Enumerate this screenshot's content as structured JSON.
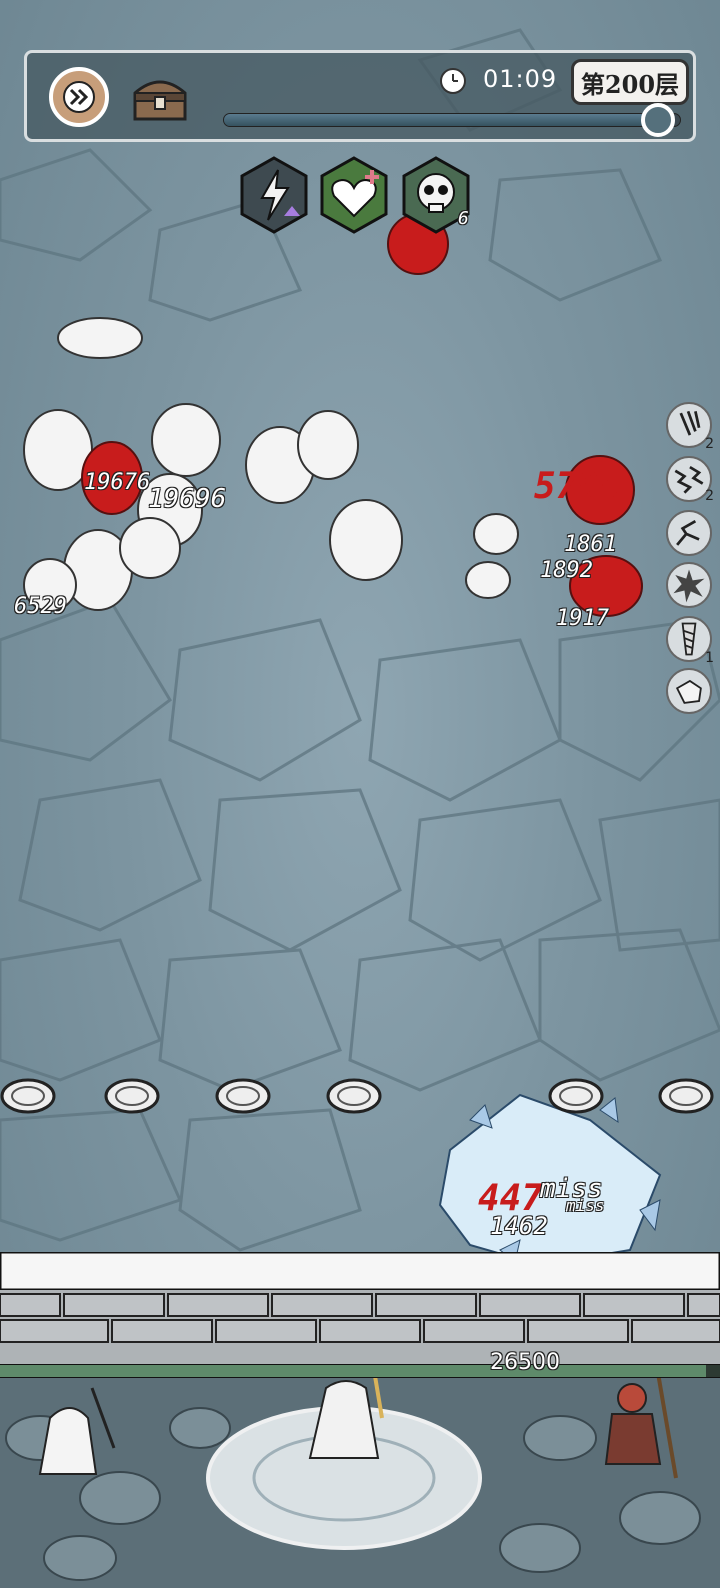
{
  "hud": {
    "fast_forward_icon": "fast-forward-icon",
    "chest_icon": "treasure-chest-icon",
    "clock_icon": "clock-icon",
    "timer": "01:09",
    "floor": "第200层",
    "wave_progress": 0.94
  },
  "buffs": [
    {
      "icon": "lightning-attack-up-icon"
    },
    {
      "icon": "heart-heal-icon"
    },
    {
      "icon": "skull-icon",
      "count": "6"
    }
  ],
  "damage_numbers": [
    {
      "text": "19676"
    },
    {
      "text": "19696"
    },
    {
      "text": "6529"
    },
    {
      "text": "5795",
      "style": "red"
    },
    {
      "text": "1861"
    },
    {
      "text": "1892"
    },
    {
      "text": "1917"
    },
    {
      "text": "447",
      "style": "red"
    },
    {
      "text": "miss"
    },
    {
      "text": "miss"
    },
    {
      "text": "1462"
    }
  ],
  "skills": [
    {
      "icon": "claw-slash-icon",
      "count": "2"
    },
    {
      "icon": "chain-lightning-icon",
      "count": "2"
    },
    {
      "icon": "crack-icon",
      "count": ""
    },
    {
      "icon": "burst-icon",
      "count": ""
    },
    {
      "icon": "drill-icon",
      "count": "1"
    },
    {
      "icon": "stone-block-icon",
      "count": ""
    }
  ],
  "wall": {
    "hp": "26500",
    "hp_fraction": 0.98
  },
  "colors": {
    "enemy_red": "#c81c1c",
    "hud_bg": "#46585f",
    "wall_hp": "#5e8a6a"
  }
}
